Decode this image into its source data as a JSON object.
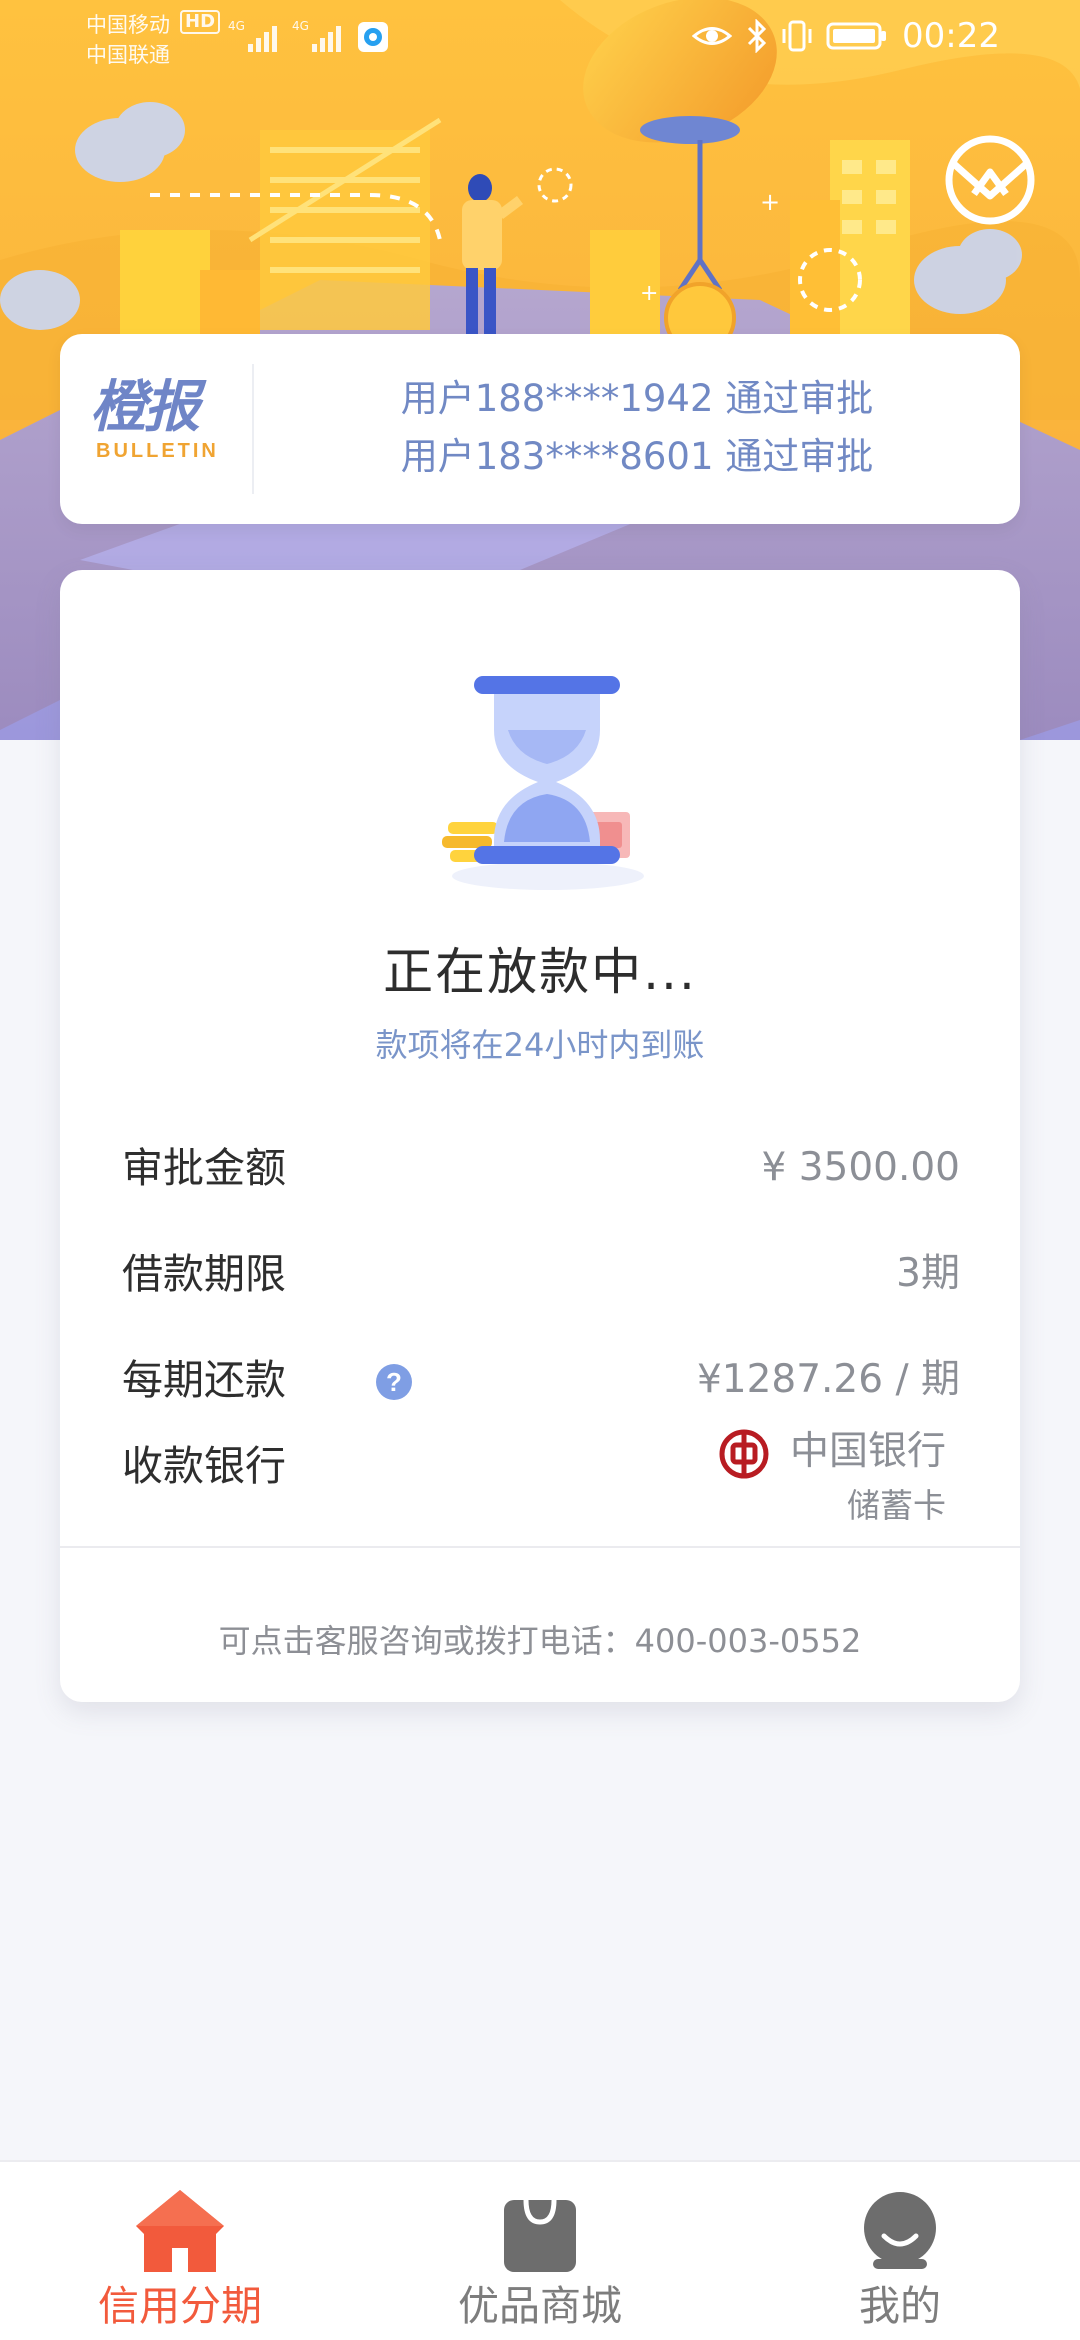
{
  "status_bar": {
    "carrier_1": "中国移动",
    "carrier_2": "中国联通",
    "hd": "HD",
    "time": "00:22"
  },
  "bulletin": {
    "logo_cn": "橙报",
    "logo_en": "BULLETIN",
    "lines": [
      "用户188****1942 通过审批",
      "用户183****8601 通过审批"
    ]
  },
  "loan_status": {
    "title": "正在放款中...",
    "subtitle": "款项将在24小时内到账"
  },
  "details": {
    "approved_amount": {
      "label": "审批金额",
      "value": "¥ 3500.00"
    },
    "loan_term": {
      "label": "借款期限",
      "value": "3期"
    },
    "installment": {
      "label": "每期还款",
      "value": "¥1287.26 / 期",
      "help": "?"
    },
    "bank": {
      "label": "收款银行",
      "name": "中国银行",
      "card_type": "储蓄卡"
    }
  },
  "contact": {
    "text": "可点击客服咨询或拨打电话：400-003-0552"
  },
  "tabs": [
    {
      "label": "信用分期",
      "icon": "home-icon",
      "active": true
    },
    {
      "label": "优品商城",
      "icon": "shopping-bag-icon",
      "active": false
    },
    {
      "label": "我的",
      "icon": "profile-icon",
      "active": false
    }
  ],
  "colors": {
    "banner_orange": "#f9a838",
    "banner_yellow": "#ffcf48",
    "accent_blue": "#7189c4",
    "tab_active": "#f25a3c",
    "bank_red": "#b81c22"
  }
}
